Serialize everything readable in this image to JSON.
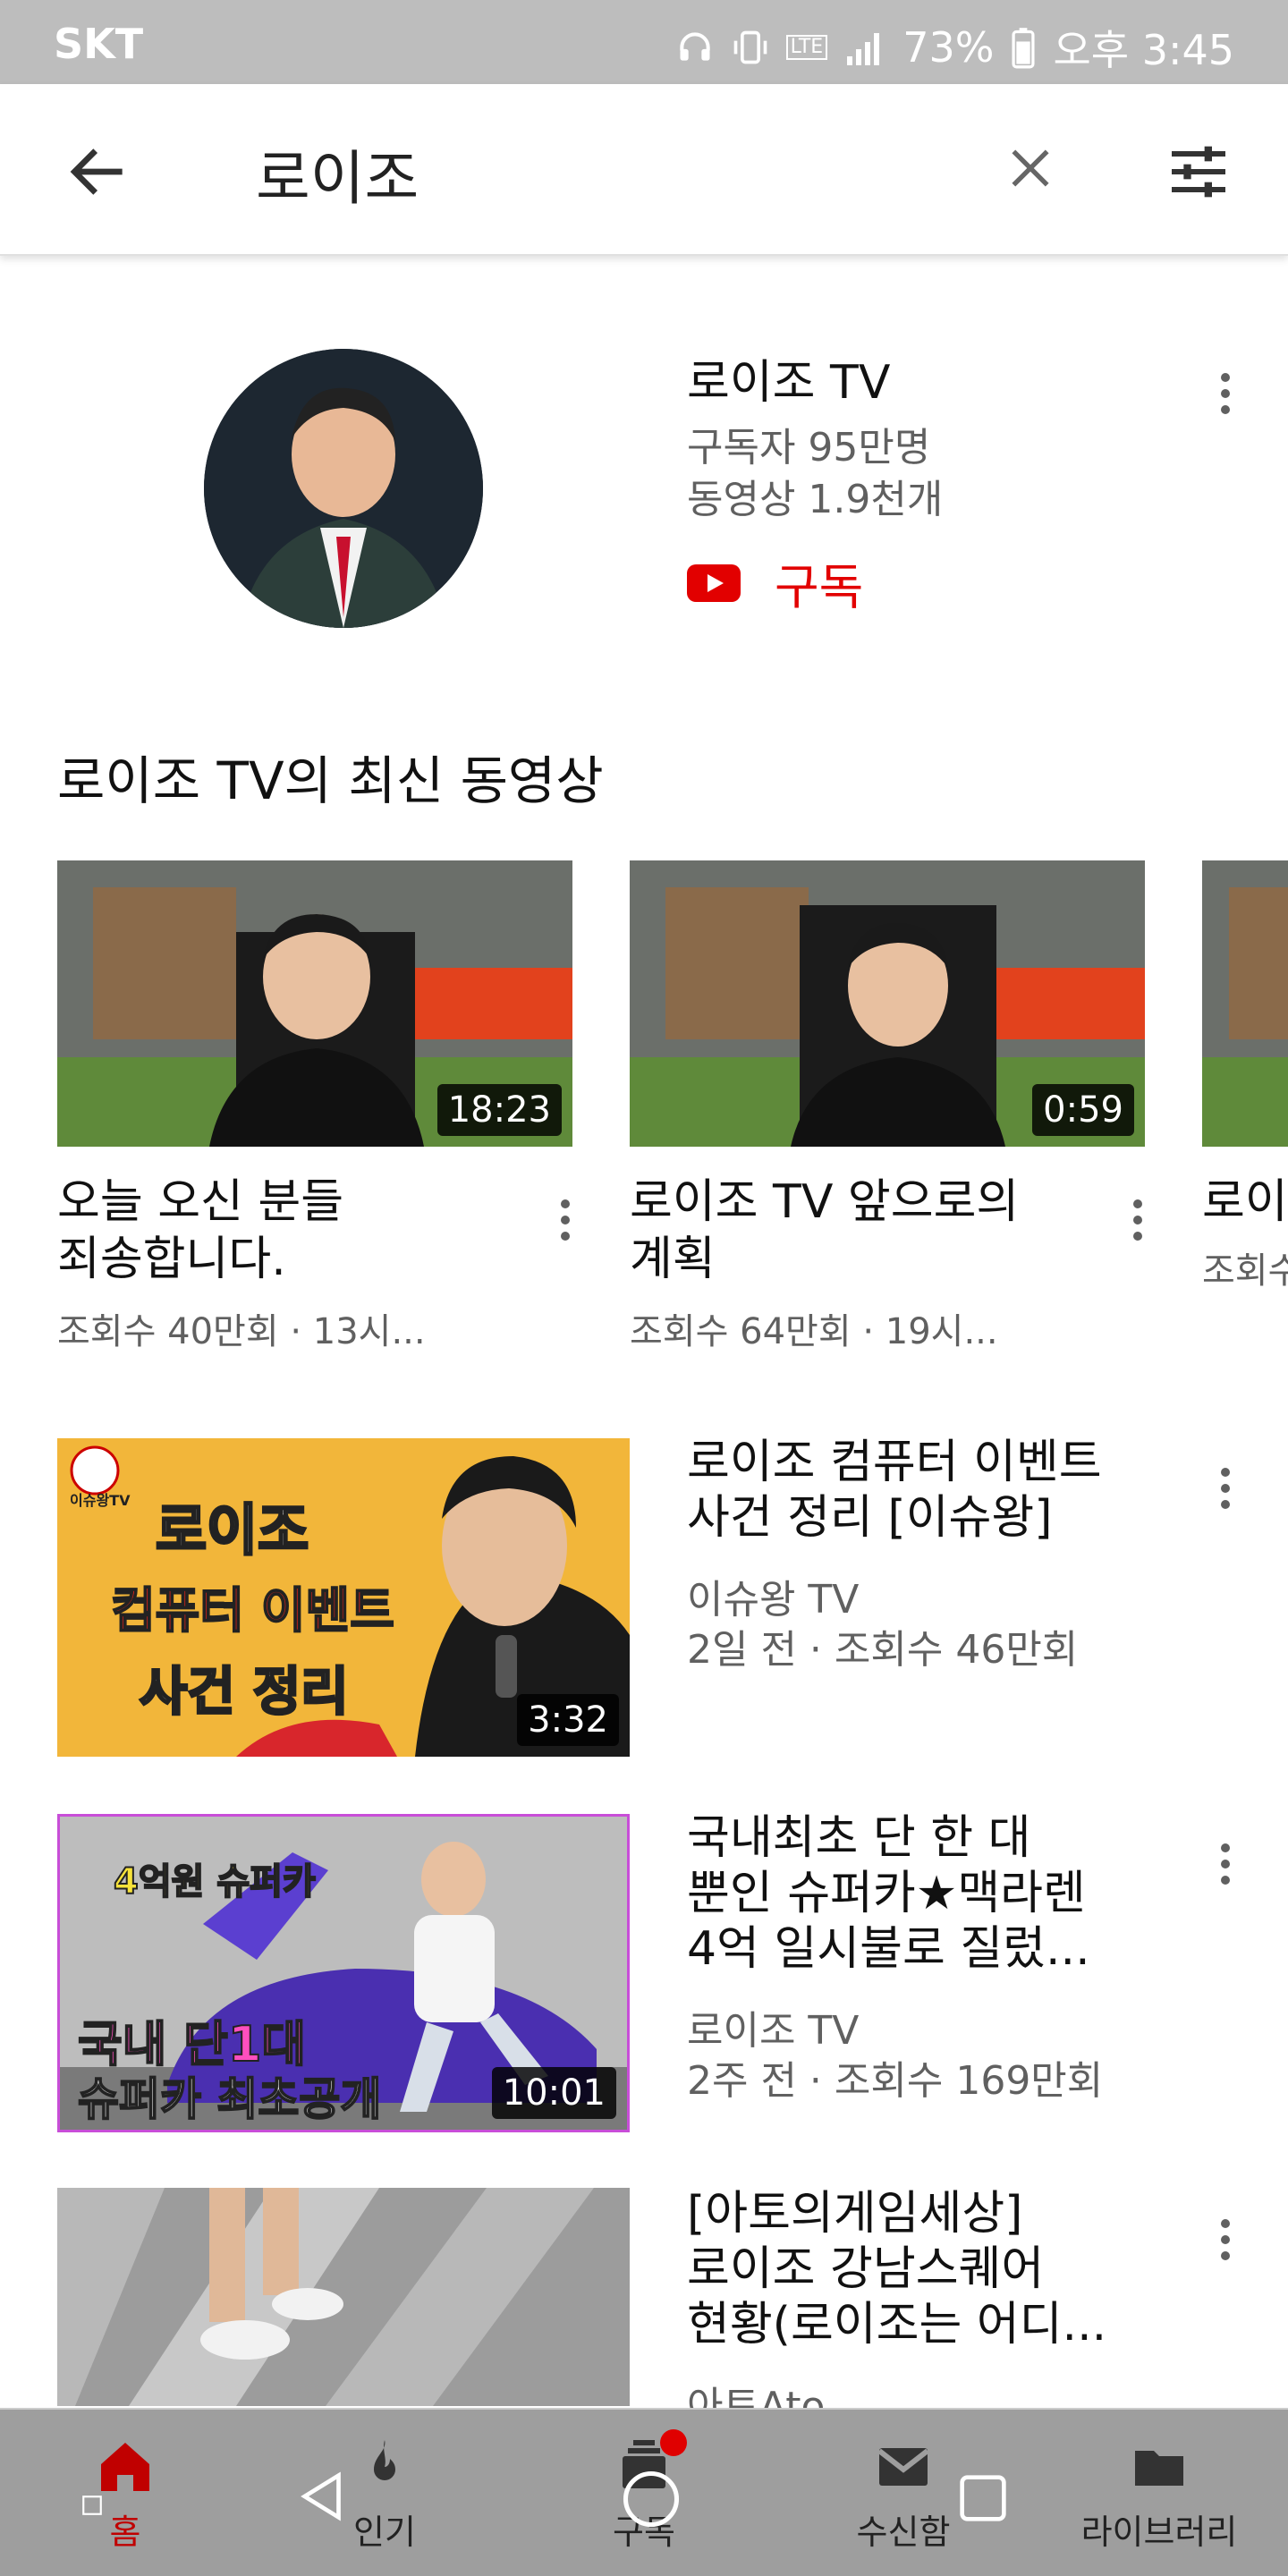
{
  "status_bar": {
    "carrier": "SKT",
    "network": "LTE",
    "battery": "73%",
    "time": "오후 3:45"
  },
  "search": {
    "query": "로이조"
  },
  "channel": {
    "name": "로이조 TV",
    "subscribers": "구독자 95만명",
    "videos": "동영상 1.9천개",
    "subscribe_label": "구독"
  },
  "latest_section": {
    "title": "로이조 TV의 최신 동영상",
    "videos": [
      {
        "title_line1": "오늘 오신 분들",
        "title_line2": "죄송합니다.",
        "meta": "조회수 40만회 · 13시...",
        "duration": "18:23"
      },
      {
        "title_line1": "로이조 TV 앞으로의",
        "title_line2": "계획",
        "meta": "조회수 64만회 · 19시...",
        "duration": "0:59"
      },
      {
        "title_line1": "로이",
        "title_line2": "",
        "meta": "조회수",
        "duration": ""
      }
    ]
  },
  "results": [
    {
      "title_line1": "로이조 컴퓨터 이벤트",
      "title_line2": "사건 정리 [이슈왕]",
      "title_line3": "",
      "channel": "이슈왕 TV",
      "meta": "2일 전 · 조회수 46만회",
      "duration": "3:32",
      "thumb_text": [
        "로이조",
        "컴퓨터 이벤트",
        "사건 정리"
      ],
      "thumb_badge": "이슈왕TV"
    },
    {
      "title_line1": "국내최초 단 한 대",
      "title_line2": "뿐인 슈퍼카★맥라렌",
      "title_line3": "4억 일시불로 질렀...",
      "channel": "로이조 TV",
      "meta": "2주 전 · 조회수 169만회",
      "duration": "10:01",
      "thumb_text": [
        "4억원 슈퍼카",
        "국내 단1대",
        "슈퍼카 최초공개"
      ]
    },
    {
      "title_line1": "[아토의게임세상]",
      "title_line2": "로이조 강남스퀘어",
      "title_line3": "현황(로이조는 어디...",
      "channel": "아토Ato",
      "meta": "",
      "duration": ""
    }
  ],
  "bottom_nav": {
    "items": [
      {
        "label": "홈",
        "icon": "home-icon",
        "active": true
      },
      {
        "label": "인기",
        "icon": "flame-icon",
        "active": false
      },
      {
        "label": "구독",
        "icon": "subscriptions-icon",
        "active": false
      },
      {
        "label": "수신함",
        "icon": "inbox-icon",
        "active": false
      },
      {
        "label": "라이브러리",
        "icon": "library-icon",
        "active": false
      }
    ]
  },
  "colors": {
    "accent": "#e20000",
    "status_bar": "#bdbdbd",
    "nav_bar": "#9e9e9e",
    "meta_text": "#606060"
  }
}
